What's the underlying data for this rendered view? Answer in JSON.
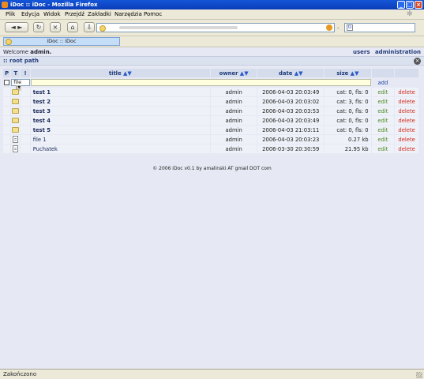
{
  "window": {
    "title": "iDoc :: iDoc - Mozilla Firefox",
    "min_glyph": "_",
    "max_glyph": "□",
    "close_glyph": "×"
  },
  "menu": [
    "Plik",
    "Edycja",
    "Widok",
    "Przejdź",
    "Zakładki",
    "Narzędzia",
    "Pomoc"
  ],
  "nav": {
    "back_glyph": "◄",
    "forward_glyph": "►",
    "reload_glyph": "↻",
    "stop_glyph": "×",
    "home_glyph": "⌂",
    "dash": "-",
    "search_engine_letter": "G"
  },
  "tab": {
    "label": "iDoc :: iDoc"
  },
  "header": {
    "welcome_prefix": "Welcome",
    "welcome_user": "admin.",
    "link_users": "users",
    "link_admin": "administration"
  },
  "path": {
    "label": ":: root path",
    "close_glyph": "×"
  },
  "columns": {
    "p": "P",
    "t": "T",
    "bang": "!",
    "title": "title",
    "owner": "owner",
    "date": "date",
    "size": "size",
    "sort_up": "▲",
    "sort_down": "▼"
  },
  "filter": {
    "type_value": "file",
    "add_label": "add"
  },
  "rows": [
    {
      "type": "folder",
      "title": "test 1",
      "owner": "admin",
      "date": "2006-04-03 20:03:49",
      "size": "cat: 0, fls: 0",
      "edit": "edit",
      "delete": "delete"
    },
    {
      "type": "folder",
      "title": "test 2",
      "owner": "admin",
      "date": "2006-04-03 20:03:02",
      "size": "cat: 3, fls: 0",
      "edit": "edit",
      "delete": "delete"
    },
    {
      "type": "folder",
      "title": "test 3",
      "owner": "admin",
      "date": "2006-04-03 20:03:53",
      "size": "cat: 0, fls: 0",
      "edit": "edit",
      "delete": "delete"
    },
    {
      "type": "folder",
      "title": "test 4",
      "owner": "admin",
      "date": "2006-04-03 20:03:49",
      "size": "cat: 0, fls: 0",
      "edit": "edit",
      "delete": "delete"
    },
    {
      "type": "folder",
      "title": "test 5",
      "owner": "admin",
      "date": "2006-04-03 21:03:11",
      "size": "cat: 0, fls: 0",
      "edit": "edit",
      "delete": "delete"
    },
    {
      "type": "file",
      "title": "file 1",
      "owner": "admin",
      "date": "2006-04-03 20:03:23",
      "size": "0.27 kb",
      "edit": "edit",
      "delete": "delete"
    },
    {
      "type": "file",
      "title": "Puchatek",
      "owner": "admin",
      "date": "2006-03-30 20:30:59",
      "size": "21.95 kb",
      "edit": "edit",
      "delete": "delete"
    }
  ],
  "footer": "© 2006 iDoc v0.1 by amalinski AT gmail DOT com",
  "status": "Zakończono",
  "colors": {
    "titlebar": "#0a3cb8",
    "content_bg": "#e6e9f3",
    "header_bg": "#d5dcec",
    "edit": "#4d8a22",
    "delete": "#d4281c"
  }
}
